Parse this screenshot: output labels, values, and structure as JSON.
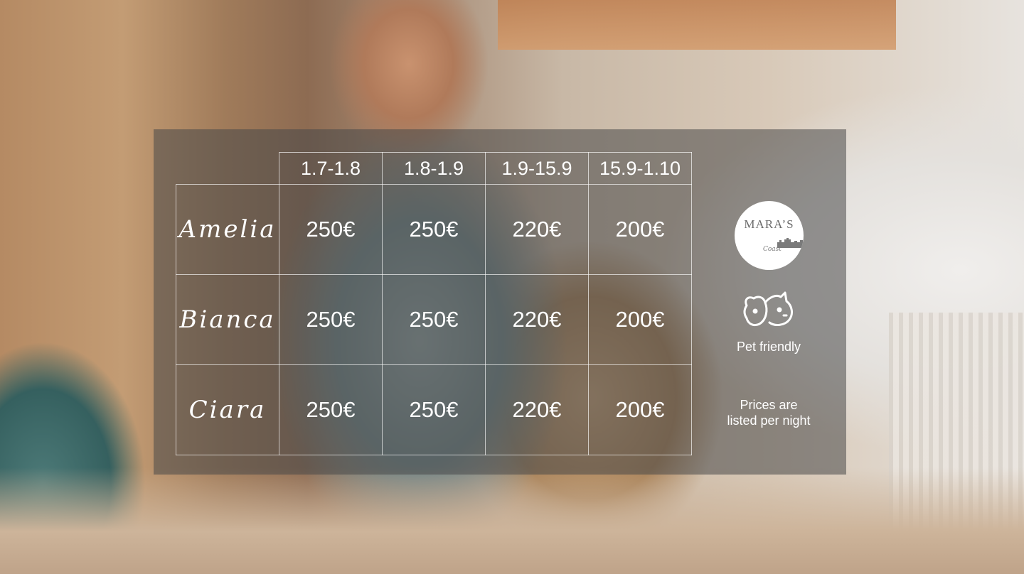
{
  "periods": [
    "1.7-1.8",
    "1.8-1.9",
    "1.9-15.9",
    "15.9-1.10"
  ],
  "rooms": [
    {
      "name": "Amelia",
      "prices": [
        "250€",
        "250€",
        "220€",
        "200€"
      ]
    },
    {
      "name": "Bianca",
      "prices": [
        "250€",
        "250€",
        "220€",
        "200€"
      ]
    },
    {
      "name": "Ciara",
      "prices": [
        "250€",
        "250€",
        "220€",
        "200€"
      ]
    }
  ],
  "logo": {
    "title": "MARA’S",
    "subtitle": "Coast"
  },
  "pet": {
    "label": "Pet friendly",
    "icon": "pet-icon"
  },
  "note": {
    "line1": "Prices are",
    "line2": "listed per night"
  },
  "colors": {
    "panel": "#484848",
    "text": "#ffffff",
    "logo_bg": "#ffffff",
    "logo_text": "#6c6c6c"
  }
}
